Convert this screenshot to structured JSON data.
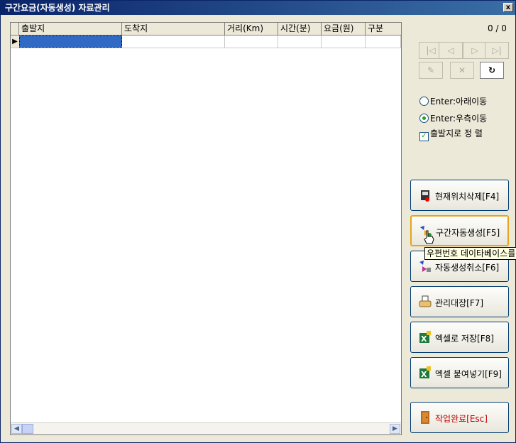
{
  "window": {
    "title": "구간요금(자동생성) 자료관리",
    "close_glyph": "x"
  },
  "grid": {
    "columns": [
      "출발지",
      "도착지",
      "거리(Km)",
      "시간(분)",
      "요금(원)",
      "구분"
    ],
    "row_indicator": "▶"
  },
  "record_counter": "0 / 0",
  "nav_buttons": {
    "first": "|◁",
    "prev": "◁",
    "next": "▷",
    "last": "▷|",
    "edit": "✎",
    "cancel": "✕",
    "refresh": "↻"
  },
  "options": {
    "enter_down": "Enter:아래이동",
    "enter_right": "Enter:우측이동",
    "sort_by_origin": "출발지로 정 렬",
    "enter_down_selected": false,
    "enter_right_selected": true,
    "sort_checked": true
  },
  "actions": {
    "delete_current": "현재위치삭제[F4]",
    "auto_generate": "구간자동생성[F5]",
    "cancel_generate": "자동생성취소[F6]",
    "ledger": "관리대장[F7]",
    "save_excel": "엑셀로 저장[F8]",
    "paste_excel": "엑셀 붙여넣기[F9]",
    "finish": "작업완료[Esc]"
  },
  "tooltip": "우편번호 데이타베이스를",
  "colors": {
    "titlebar": "#0a246a",
    "selected_cell": "#316ac5",
    "finish_text": "#c00000"
  }
}
